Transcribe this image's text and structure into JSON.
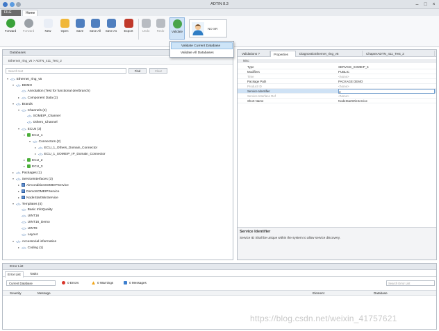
{
  "window": {
    "title": "ADTIN 8.3"
  },
  "ribbon_tabs": [
    {
      "label": "FILE"
    },
    {
      "label": "Home"
    }
  ],
  "ribbon": {
    "buttons": [
      {
        "label": "Forward",
        "icon": "forward-icon",
        "color": "#3aa23a"
      },
      {
        "label": "Forward",
        "icon": "forward-icon",
        "color": "#9aa0a6"
      },
      {
        "label": "New",
        "icon": "new-file-icon",
        "color": "#e9eef6"
      },
      {
        "label": "Open",
        "icon": "open-folder-icon",
        "color": "#f0b73a"
      },
      {
        "label": "Save",
        "icon": "save-icon",
        "color": "#4f7fbf"
      },
      {
        "label": "Save All",
        "icon": "save-all-icon",
        "color": "#4f7fbf"
      },
      {
        "label": "Save As",
        "icon": "save-as-icon",
        "color": "#4f7fbf"
      },
      {
        "label": "Export",
        "icon": "export-icon",
        "color": "#c0392b"
      },
      {
        "label": "Undo",
        "icon": "undo-icon",
        "color": "#b8bcc2"
      },
      {
        "label": "Redo",
        "icon": "redo-icon",
        "color": "#b8bcc2"
      },
      {
        "label": "Validate",
        "icon": "validate-icon",
        "color": "#47a44b"
      }
    ],
    "user": {
      "name": "NO SR"
    }
  },
  "validate_menu": {
    "items": [
      "Validate Current Database",
      "Validate All Databases"
    ]
  },
  "database_panel": {
    "title": "Databases",
    "breadcrumb": "Ethernet_ring_v5  >  ADTN_411_Test_2",
    "search_placeholder": "Search text",
    "find_label": "Find",
    "clear_label": "Clear",
    "tree": [
      {
        "depth": 0,
        "exp": "−",
        "icon": "tag",
        "label": "Ethernet_ring_v5"
      },
      {
        "depth": 1,
        "exp": "−",
        "icon": "tag",
        "label": "DEMO"
      },
      {
        "depth": 2,
        "exp": "",
        "icon": "tag",
        "label": "Annotation (Test for functional dev/branch)"
      },
      {
        "depth": 2,
        "exp": "+",
        "icon": "tag",
        "label": "Component Data (2)"
      },
      {
        "depth": 1,
        "exp": "−",
        "icon": "tag",
        "label": "Brands"
      },
      {
        "depth": 2,
        "exp": "−",
        "icon": "tag",
        "label": "Channels (2)"
      },
      {
        "depth": 3,
        "exp": "",
        "icon": "tag",
        "label": "SOMEIP_Channel"
      },
      {
        "depth": 3,
        "exp": "",
        "icon": "tag",
        "label": "Others_Channel"
      },
      {
        "depth": 2,
        "exp": "−",
        "icon": "tag",
        "label": "ECUs (3)"
      },
      {
        "depth": 3,
        "exp": "−",
        "icon": "green",
        "label": "ECU_1"
      },
      {
        "depth": 4,
        "exp": "−",
        "icon": "tag",
        "label": "Connectors (2)"
      },
      {
        "depth": 5,
        "exp": "+",
        "icon": "tag",
        "label": "ECU_1_Others_Domain_Connector"
      },
      {
        "depth": 5,
        "exp": "+",
        "icon": "tag",
        "label": "ECU_1_SOMEIP_IP_Domain_Connector"
      },
      {
        "depth": 3,
        "exp": "+",
        "icon": "green",
        "label": "ECU_2"
      },
      {
        "depth": 3,
        "exp": "+",
        "icon": "green",
        "label": "ECU_3"
      },
      {
        "depth": 1,
        "exp": "+",
        "icon": "tag",
        "label": "Packages (1)"
      },
      {
        "depth": 1,
        "exp": "−",
        "icon": "tag",
        "label": "ServiceInterfaces (3)"
      },
      {
        "depth": 2,
        "exp": "+",
        "icon": "svc",
        "label": "AirConditionSOMEIPService"
      },
      {
        "depth": 2,
        "exp": "+",
        "icon": "svc",
        "label": "DemoSOMEIPService"
      },
      {
        "depth": 2,
        "exp": "+",
        "icon": "svc",
        "label": "NodeStartWinService"
      },
      {
        "depth": 1,
        "exp": "−",
        "icon": "tag",
        "label": "Templates (4)"
      },
      {
        "depth": 2,
        "exp": "",
        "icon": "tag",
        "label": "Basic InfoQuality"
      },
      {
        "depth": 2,
        "exp": "",
        "icon": "tag",
        "label": "UINT16"
      },
      {
        "depth": 2,
        "exp": "",
        "icon": "tag",
        "label": "UINT16_Demo"
      },
      {
        "depth": 2,
        "exp": "",
        "icon": "tag",
        "label": "UINT8"
      },
      {
        "depth": 2,
        "exp": "",
        "icon": "tag",
        "label": "Layout"
      },
      {
        "depth": 1,
        "exp": "−",
        "icon": "tag",
        "label": "Accessorial information"
      },
      {
        "depth": 2,
        "exp": "+",
        "icon": "tag",
        "label": "Coding (1)"
      }
    ]
  },
  "right_panel": {
    "tabs": [
      "Validations ?",
      "Properties",
      "DiagnosticEthernet_ring_v5",
      "ChapterADTN_411_Test_2"
    ],
    "category": "Misc",
    "properties": [
      {
        "key": "Type",
        "value": "SERVICE_SOMEIP_5",
        "muted": false
      },
      {
        "key": "Modifiers",
        "value": "PUBLIC",
        "muted": false
      },
      {
        "key": "Time",
        "value": "<None>",
        "muted": true
      },
      {
        "key": "Package Path",
        "value": "PACKAGE DEMO",
        "muted": false
      },
      {
        "key": "Product ID",
        "value": "<None>",
        "muted": true
      },
      {
        "key": "Service Identifier",
        "value": "3",
        "muted": false
      },
      {
        "key": "Service Interface Ref",
        "value": "<None>",
        "muted": true
      },
      {
        "key": "Short Name",
        "value": "NodeStartWinService",
        "muted": false
      }
    ],
    "selected_index": 5,
    "description_title": "Service Identifier",
    "description_text": "Service ID Shall be unique within the system to allow service discovery."
  },
  "error_panel": {
    "title": "Error List",
    "tabs": [
      "Error List",
      "Tasks"
    ],
    "filter": "Current Database",
    "errors": "0 Errors",
    "warnings": "0 Warnings",
    "messages": "0 Messages",
    "search_placeholder": "Search Error List",
    "columns": [
      "Severity",
      "Message",
      "Element",
      "Database"
    ],
    "colors": {
      "error": "#d9362b",
      "warning": "#f2a516",
      "message": "#3d7fcf"
    }
  },
  "watermark": "https://blog.csdn.net/weixin_41757621"
}
